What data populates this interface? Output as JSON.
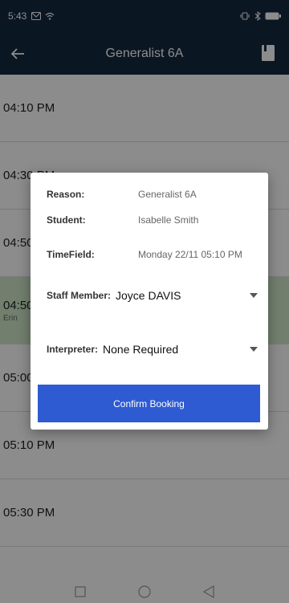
{
  "status_bar": {
    "time": "5:43"
  },
  "app_bar": {
    "title": "Generalist 6A"
  },
  "slots": [
    {
      "time": "04:10 PM",
      "sub": ""
    },
    {
      "time": "04:30 PM",
      "sub": ""
    },
    {
      "time": "04:50 PM",
      "sub": ""
    },
    {
      "time": "04:50 PM",
      "sub": "Erin"
    },
    {
      "time": "05:00 PM",
      "sub": ""
    },
    {
      "time": "05:10 PM",
      "sub": ""
    },
    {
      "time": "05:30 PM",
      "sub": ""
    }
  ],
  "dialog": {
    "reason_label": "Reason:",
    "reason_value": "Generalist 6A",
    "student_label": "Student:",
    "student_value": "Isabelle Smith",
    "timefield_label": "TimeField:",
    "timefield_value": "Monday 22/11 05:10 PM",
    "staff_label": "Staff Member:",
    "staff_value": "Joyce DAVIS",
    "interpreter_label": "Interpreter:",
    "interpreter_value": "None Required",
    "confirm_label": "Confirm Booking"
  },
  "colors": {
    "app_bar": "#152841",
    "confirm_button": "#2e5bd2",
    "booked_slot": "#cfe8c9"
  }
}
